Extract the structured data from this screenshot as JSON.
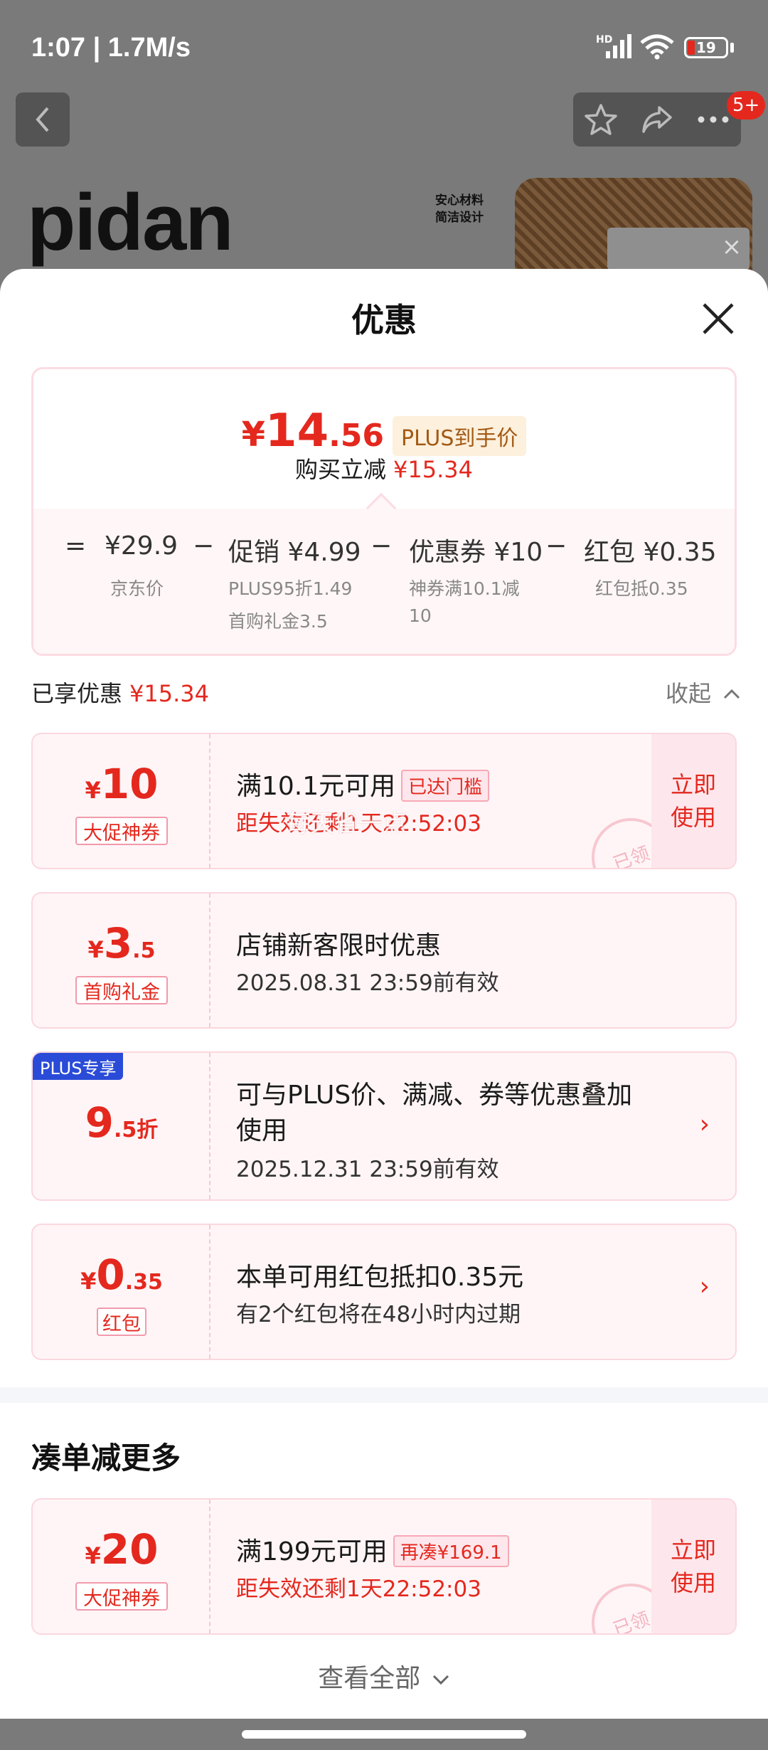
{
  "status": {
    "time": "1:07 | 1.7M/s",
    "battery": "19",
    "signal_label": "HD"
  },
  "nav": {
    "badge": "5+"
  },
  "background": {
    "brand": "pidan",
    "tagline_1": "安心材料",
    "tagline_2": "简洁设计"
  },
  "sheet": {
    "title": "优惠",
    "summary": {
      "price_yen": "¥",
      "price_int": "14",
      "price_dec": ".56",
      "plus_label": "PLUS到手价",
      "reduce_label": "购买立减",
      "reduce_value": "¥15.34",
      "formula": [
        {
          "op": "=",
          "text": "¥29.9",
          "subs": [
            "京东价"
          ]
        },
        {
          "op": "−",
          "text": "促销 ¥4.99",
          "subs": [
            "PLUS95折1.49",
            "首购礼金3.5"
          ]
        },
        {
          "op": "−",
          "text": "优惠券 ¥10",
          "subs": [
            "神券满10.1减",
            "10"
          ]
        },
        {
          "op": "−",
          "text": "红包 ¥0.35",
          "subs": [
            "红包抵0.35"
          ]
        }
      ]
    },
    "enjoyed": {
      "label": "已享优惠",
      "value": "¥15.34",
      "collapse": "收起"
    },
    "coupons": [
      {
        "yen": "¥",
        "big": "10",
        "small": "",
        "tag": "大促神券",
        "title": "满10.1元可用",
        "title_tag": "已达门槛",
        "sub": "距失效还剩1天22:52:03",
        "action": "立即使用",
        "stamp": "已领"
      },
      {
        "yen": "¥",
        "big": "3",
        "small": ".5",
        "tag": "首购礼金",
        "title": "店铺新客限时优惠",
        "sub": "2025.08.31 23:59前有效"
      },
      {
        "corner": "PLUS专享",
        "big": "9",
        "small": ".5折",
        "title_1": "可与PLUS价、满减、券等优惠叠加",
        "title_2": "使用",
        "sub": "2025.12.31 23:59前有效"
      },
      {
        "yen": "¥",
        "big": "0",
        "small": ".35",
        "tag": "红包",
        "title": "本单可用红包抵扣0.35元",
        "sub": "有2个红包将在48小时内过期"
      }
    ],
    "watermark": "每天省一点",
    "more": {
      "title": "凑单减更多",
      "coupon": {
        "yen": "¥",
        "big": "20",
        "tag": "大促神券",
        "title": "满199元可用",
        "title_tag": "再凑¥169.1",
        "sub": "距失效还剩1天22:52:03",
        "action": "立即使用",
        "stamp": "已领"
      },
      "view_all": "查看全部"
    }
  }
}
